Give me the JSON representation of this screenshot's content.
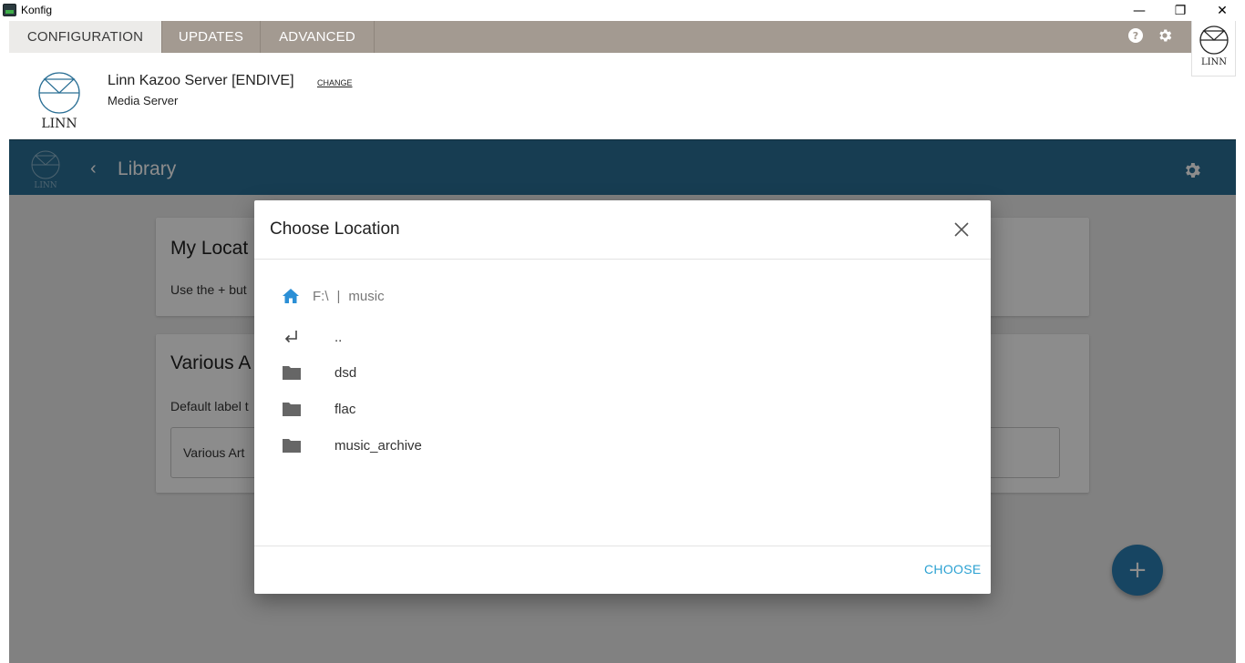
{
  "window": {
    "title": "Konfig",
    "controls": {
      "minimize": "—",
      "restore": "❐",
      "close": "✕"
    }
  },
  "tabs": [
    {
      "label": "CONFIGURATION",
      "active": true
    },
    {
      "label": "UPDATES",
      "active": false
    },
    {
      "label": "ADVANCED",
      "active": false
    }
  ],
  "toolbar": {
    "help_icon": "help-icon",
    "settings_icon": "gear-icon"
  },
  "brand": {
    "logo_text": "LINN",
    "logo_icon": "linn-logo-icon"
  },
  "device": {
    "name": "Linn Kazoo Server [ENDIVE]",
    "change_label": "CHANGE",
    "type": "Media Server"
  },
  "app_header": {
    "title": "Library",
    "back_icon": "chevron-left-icon",
    "settings_icon": "gear-icon"
  },
  "cards": {
    "my_locations": {
      "title": "My Locat",
      "description": "Use the + but"
    },
    "various_artists": {
      "title": "Various A",
      "description": "Default label t",
      "input_value": "Various Art"
    }
  },
  "fab": {
    "label": "+"
  },
  "dialog": {
    "title": "Choose Location",
    "close_icon": "close-icon",
    "breadcrumb": {
      "home_icon": "home-icon",
      "drive": "F:\\",
      "separator": "|",
      "folder": "music"
    },
    "entries": [
      {
        "label": "..",
        "icon": "return-arrow-icon"
      },
      {
        "label": "dsd",
        "icon": "folder-icon"
      },
      {
        "label": "flac",
        "icon": "folder-icon"
      },
      {
        "label": "music_archive",
        "icon": "folder-icon"
      }
    ],
    "choose_label": "CHOOSE"
  },
  "colors": {
    "tabbar": "#a39a91",
    "app_header": "#2a6f95",
    "accent": "#2ba1d2",
    "fab": "#2b7fb2"
  }
}
